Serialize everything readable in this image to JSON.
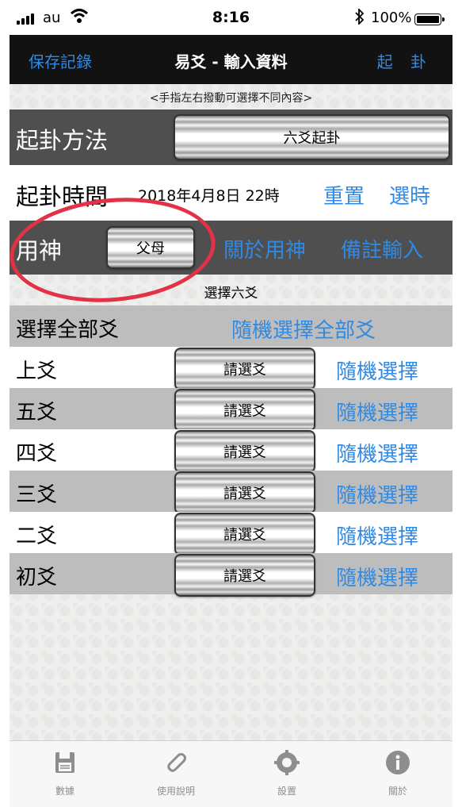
{
  "status_bar": {
    "carrier": "au",
    "time": "8:16",
    "battery": "100%"
  },
  "nav": {
    "left_button": "保存記錄",
    "title": "易爻 - 輸入資料",
    "right_button": "起 卦"
  },
  "hint": "<手指左右撥動可選擇不同內容>",
  "method": {
    "label": "起卦方法",
    "value": "六爻起卦"
  },
  "time_row": {
    "label": "起卦時間",
    "value": "2018年4月8日 22時",
    "reset": "重置",
    "pick": "選時"
  },
  "yongshen": {
    "label": "用神",
    "value": "父母",
    "about": "關於用神",
    "notes": "備註輸入"
  },
  "section_title": "選擇六爻",
  "select_all": {
    "label": "選擇全部爻",
    "action": "隨機選擇全部爻"
  },
  "yao_rows": [
    {
      "label": "上爻",
      "value": "請選爻",
      "action": "隨機選擇"
    },
    {
      "label": "五爻",
      "value": "請選爻",
      "action": "隨機選擇"
    },
    {
      "label": "四爻",
      "value": "請選爻",
      "action": "隨機選擇"
    },
    {
      "label": "三爻",
      "value": "請選爻",
      "action": "隨機選擇"
    },
    {
      "label": "二爻",
      "value": "請選爻",
      "action": "隨機選擇"
    },
    {
      "label": "初爻",
      "value": "請選爻",
      "action": "隨機選擇"
    }
  ],
  "tabs": [
    {
      "label": "數據",
      "icon": "floppy-disk-icon"
    },
    {
      "label": "使用說明",
      "icon": "paperclip-icon"
    },
    {
      "label": "設置",
      "icon": "gear-icon"
    },
    {
      "label": "關於",
      "icon": "info-icon"
    }
  ],
  "colors": {
    "accent": "#2f8ae6",
    "nav_bg": "#121212",
    "dark_row": "#4f4f4f",
    "grey_row": "#bdbdbd",
    "annotation": "#e33245"
  }
}
